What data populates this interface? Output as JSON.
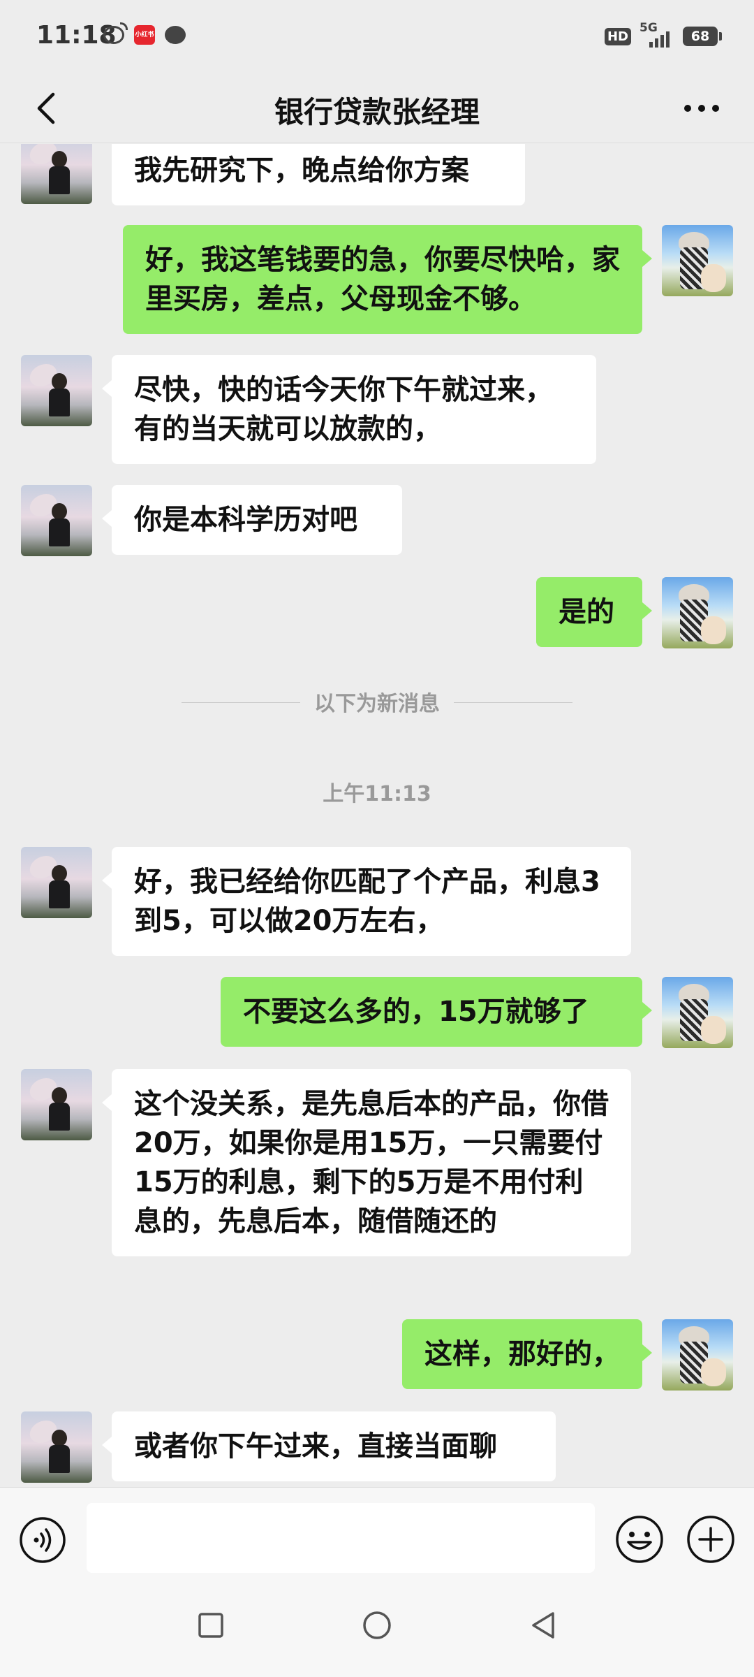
{
  "status_bar": {
    "time": "11:18",
    "left_icons": [
      "weibo-icon",
      "red-app-icon",
      "message-icon"
    ],
    "red_app_label": "小红书",
    "hd_label": "HD",
    "network_label": "5G",
    "battery": "68"
  },
  "header": {
    "title": "银行贷款张经理",
    "back_icon": "chevron-left-icon",
    "more_icon": "more-dots-icon"
  },
  "messages": [
    {
      "side": "left",
      "text": "我先研究下，晚点给你方案"
    },
    {
      "side": "right",
      "text": "好，我这笔钱要的急，你要尽快哈，家里买房，差点，父母现金不够。"
    },
    {
      "side": "left",
      "text": "尽快，快的话今天你下午就过来，有的当天就可以放款的，"
    },
    {
      "side": "left",
      "text": "你是本科学历对吧"
    },
    {
      "side": "right",
      "text": "是的"
    },
    {
      "side": "left",
      "text": "好，我已经给你匹配了个产品，利息3到5，可以做20万左右，"
    },
    {
      "side": "right",
      "text": "不要这么多的，15万就够了"
    },
    {
      "side": "left",
      "text": "这个没关系，是先息后本的产品，你借20万，如果你是用15万，一只需要付15万的利息，剩下的5万是不用付利息的，先息后本，随借随还的"
    },
    {
      "side": "right",
      "text": "这样，那好的，"
    },
    {
      "side": "left",
      "text": "或者你下午过来，直接当面聊"
    }
  ],
  "divider_text": "以下为新消息",
  "timestamp": "上午11:13",
  "input_bar": {
    "placeholder": "",
    "voice_icon": "voice-icon",
    "emoji_icon": "emoji-icon",
    "plus_icon": "plus-icon"
  },
  "nav_bar": {
    "icons": [
      "recent-apps-icon",
      "home-icon",
      "back-icon"
    ]
  }
}
